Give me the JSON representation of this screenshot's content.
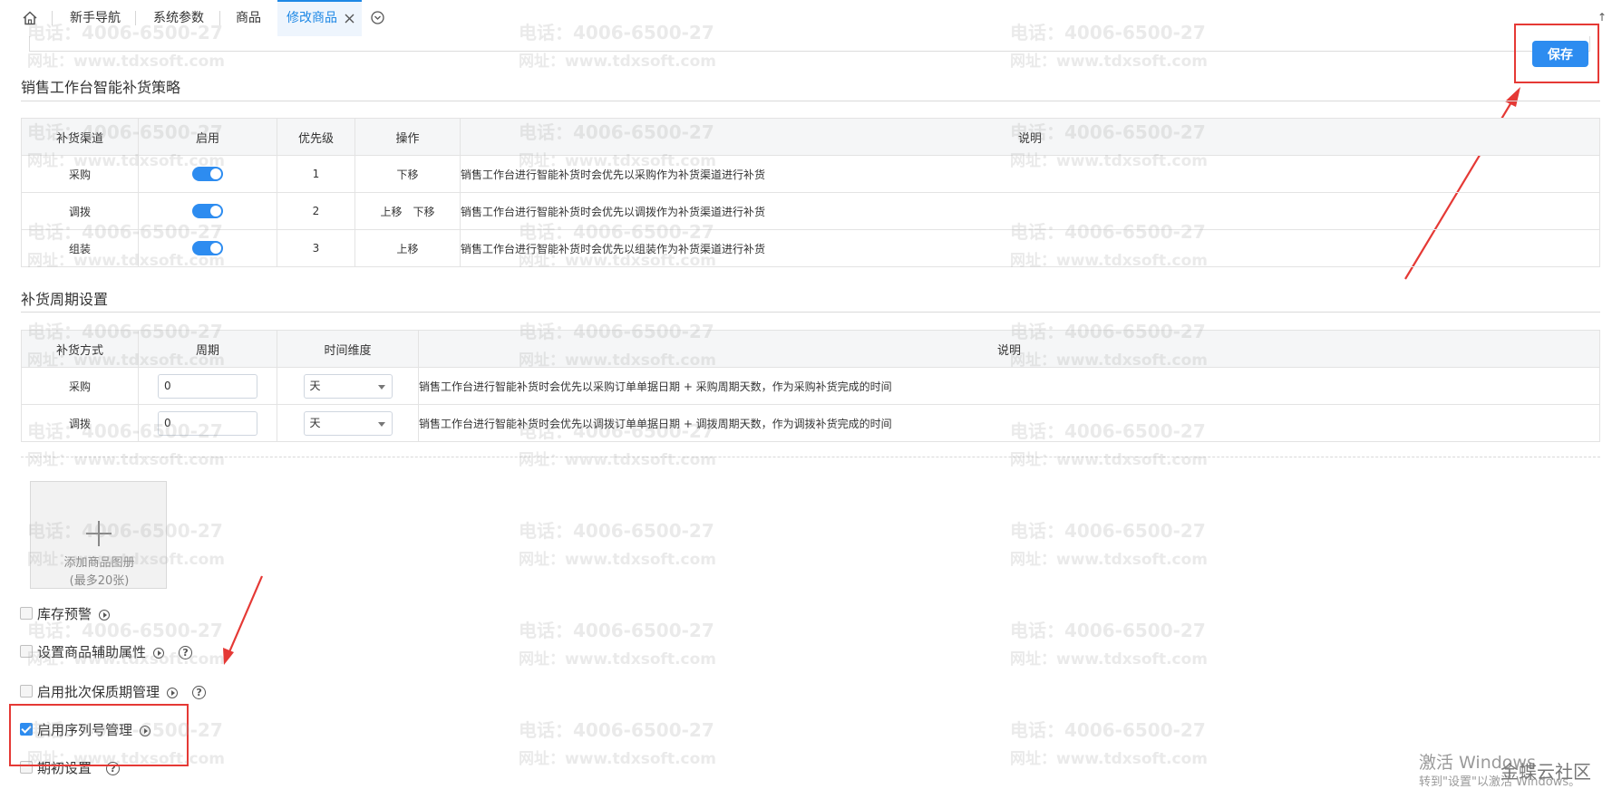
{
  "tabs": {
    "home_icon": "home-icon",
    "items": [
      "新手导航",
      "系统参数",
      "商品",
      "修改商品"
    ],
    "close_icon": "close-icon",
    "more_icon": "chevron-down-circle-icon"
  },
  "toolbar": {
    "save_label": "保存"
  },
  "replenish_strategy": {
    "title": "销售工作台智能补货策略",
    "headers": [
      "补货渠道",
      "启用",
      "优先级",
      "操作",
      "说明"
    ],
    "rows": [
      {
        "channel": "采购",
        "enabled": true,
        "priority": "1",
        "actions": [
          "下移"
        ],
        "desc": "销售工作台进行智能补货时会优先以采购作为补货渠道进行补货"
      },
      {
        "channel": "调拨",
        "enabled": true,
        "priority": "2",
        "actions": [
          "上移",
          "下移"
        ],
        "desc": "销售工作台进行智能补货时会优先以调拨作为补货渠道进行补货"
      },
      {
        "channel": "组装",
        "enabled": true,
        "priority": "3",
        "actions": [
          "上移"
        ],
        "desc": "销售工作台进行智能补货时会优先以组装作为补货渠道进行补货"
      }
    ]
  },
  "replenish_cycle": {
    "title": "补货周期设置",
    "headers": [
      "补货方式",
      "周期",
      "时间维度",
      "说明"
    ],
    "rows": [
      {
        "method": "采购",
        "period": "0",
        "unit": "天",
        "desc": "销售工作台进行智能补货时会优先以采购订单单据日期 + 采购周期天数，作为采购补货完成的时间"
      },
      {
        "method": "调拨",
        "period": "0",
        "unit": "天",
        "desc": "销售工作台进行智能补货时会优先以调拨订单单据日期 + 调拨周期天数，作为调拨补货完成的时间"
      }
    ]
  },
  "album": {
    "add_label": "添加商品图册",
    "limit_label": "(最多20张)"
  },
  "options": [
    {
      "label": "库存预警",
      "checked": false,
      "play": true,
      "help": false
    },
    {
      "label": "设置商品辅助属性",
      "checked": false,
      "play": true,
      "help": true
    },
    {
      "label": "启用批次保质期管理",
      "checked": false,
      "play": true,
      "help": true
    },
    {
      "label": "启用序列号管理",
      "checked": true,
      "play": true,
      "help": false
    },
    {
      "label": "期初设置",
      "checked": false,
      "play": false,
      "help": true
    }
  ],
  "watermark": {
    "phone": "电话：4006-6500-27",
    "site": "网址：www.tdxsoft.com"
  },
  "os_watermark": {
    "line1": "激活 Windows",
    "line2": "转到\"设置\"以激活 Windows。",
    "community": "金蝶云社区"
  },
  "colors": {
    "accent": "#2d8cf0",
    "annotation_red": "#e53935"
  }
}
